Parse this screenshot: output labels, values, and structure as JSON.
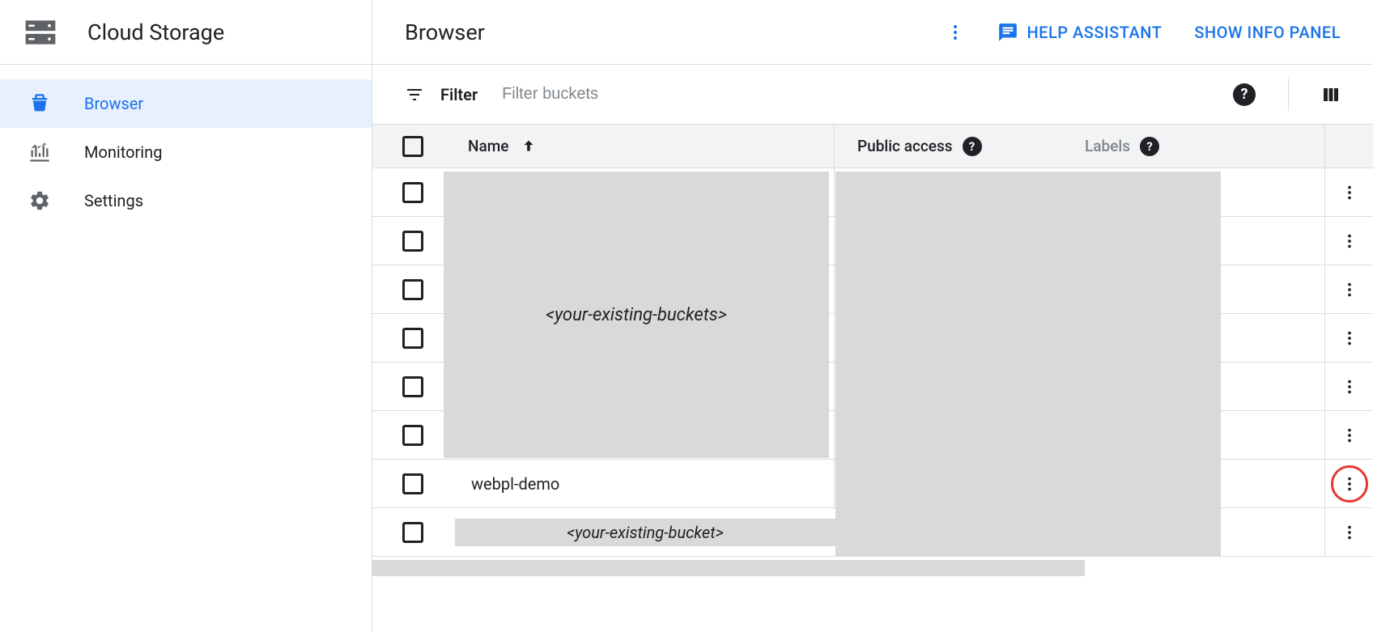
{
  "sidebar": {
    "product_title": "Cloud Storage",
    "items": [
      {
        "label": "Browser"
      },
      {
        "label": "Monitoring"
      },
      {
        "label": "Settings"
      }
    ]
  },
  "header": {
    "page_title": "Browser",
    "help_assistant": "HELP ASSISTANT",
    "show_info": "SHOW INFO PANEL"
  },
  "filter": {
    "label": "Filter",
    "placeholder": "Filter buckets"
  },
  "table": {
    "columns": {
      "name": "Name",
      "public_access": "Public access",
      "labels": "Labels"
    },
    "placeholder_many": "<your-existing-buckets>",
    "placeholder_one": "<your-existing-bucket>",
    "rows": [
      {
        "name": ""
      },
      {
        "name": ""
      },
      {
        "name": ""
      },
      {
        "name": ""
      },
      {
        "name": ""
      },
      {
        "name": ""
      },
      {
        "name": "webpl-demo",
        "highlighted": true
      },
      {
        "name": ""
      }
    ]
  }
}
